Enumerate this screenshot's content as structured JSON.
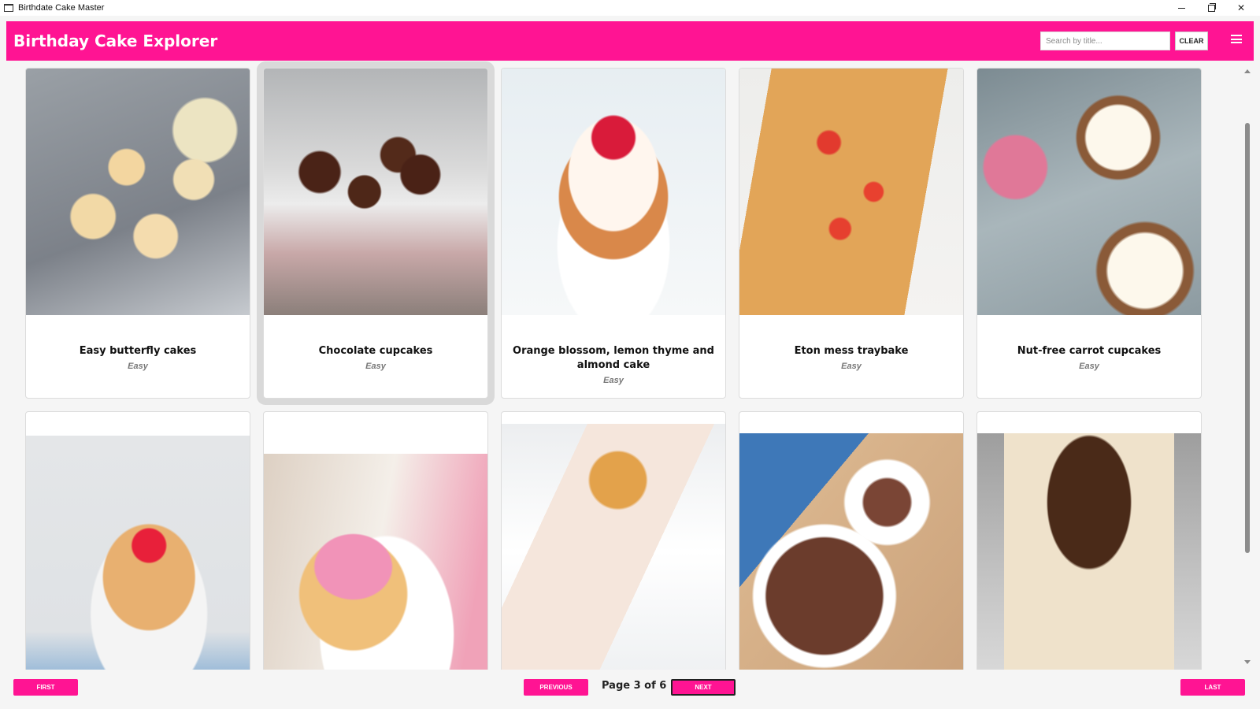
{
  "window": {
    "title": "Birthdate Cake Master"
  },
  "header": {
    "title": "Birthday Cake Explorer",
    "search_placeholder": "Search by title...",
    "search_value": "",
    "clear_label": "CLEAR"
  },
  "cards": [
    {
      "name": "Easy butterfly cakes",
      "difficulty": "Easy"
    },
    {
      "name": "Chocolate cupcakes",
      "difficulty": "Easy"
    },
    {
      "name": "Orange blossom, lemon thyme and almond cake",
      "difficulty": "Easy"
    },
    {
      "name": "Eton mess traybake",
      "difficulty": "Easy"
    },
    {
      "name": "Nut-free carrot cupcakes",
      "difficulty": "Easy"
    }
  ],
  "pagination": {
    "first_label": "FIRST",
    "previous_label": "PREVIOUS",
    "page_text": "Page 3 of 6",
    "next_label": "NEXT",
    "last_label": "LAST"
  },
  "colors": {
    "accent": "#ff1493",
    "background": "#f5f5f5"
  }
}
